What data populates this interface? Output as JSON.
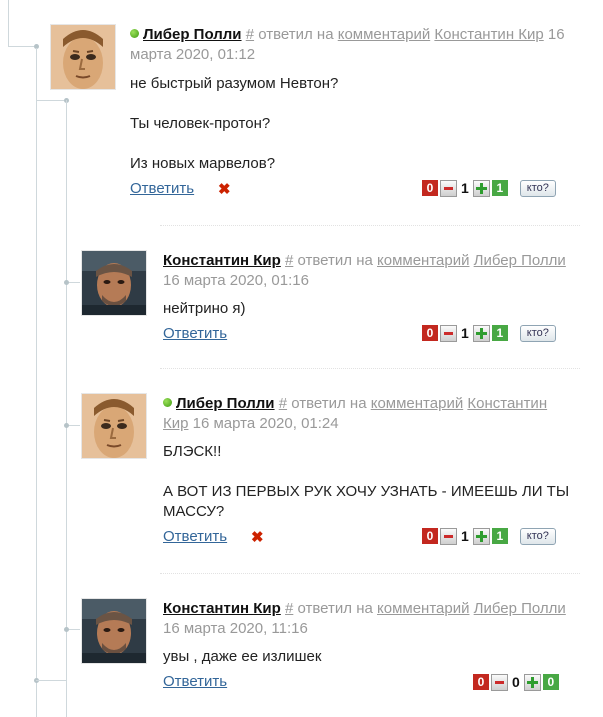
{
  "comments": [
    {
      "author": "Либер Полли",
      "online": true,
      "hash": "#",
      "replied_to": " ответил на ",
      "comment_word": "комментарий",
      "target": "Константин Кир",
      "date": "16 марта 2020, 01:12",
      "lines": [
        "не быстрый разумом Невтон?",
        "Ты человек-протон?",
        "Из новых марвелов?"
      ],
      "reply_label": "Ответить",
      "delete_icon": "x-icon",
      "votes": {
        "minus": "0",
        "total": "1",
        "plus": "1",
        "who": "кто?"
      }
    },
    {
      "author": "Константин Кир",
      "online": false,
      "hash": "#",
      "replied_to": " ответил на ",
      "comment_word": "комментарий",
      "target": "Либер Полли",
      "date": "16 марта 2020, 01:16",
      "lines": [
        "нейтрино я)"
      ],
      "reply_label": "Ответить",
      "votes": {
        "minus": "0",
        "total": "1",
        "plus": "1",
        "who": "кто?"
      }
    },
    {
      "author": "Либер Полли",
      "online": true,
      "hash": "#",
      "replied_to": " ответил на ",
      "comment_word": "комментарий",
      "target": "Константин Кир",
      "date": "16 марта 2020, 01:24",
      "lines": [
        "БЛЭСК!!",
        "А ВОТ ИЗ ПЕРВЫХ РУК ХОЧУ УЗНАТЬ - ИМЕЕШЬ ЛИ ТЫ МАССУ?"
      ],
      "reply_label": "Ответить",
      "delete_icon": "x-icon",
      "votes": {
        "minus": "0",
        "total": "1",
        "plus": "1",
        "who": "кто?"
      }
    },
    {
      "author": "Константин Кир",
      "online": false,
      "hash": "#",
      "replied_to": " ответил на ",
      "comment_word": "комментарий",
      "target": "Либер Полли",
      "date": "16 марта 2020, 11:16",
      "lines": [
        "увы , даже ее излишек"
      ],
      "reply_label": "Ответить",
      "votes": {
        "minus": "0",
        "total": "0",
        "plus": "0"
      }
    }
  ],
  "colors": {
    "link": "#336699",
    "vote_negative": "#c3281f",
    "vote_positive": "#48a844",
    "online": "#3f9a12",
    "meta": "#999999"
  }
}
